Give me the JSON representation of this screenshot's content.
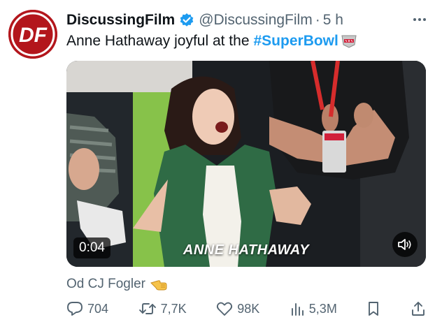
{
  "author": {
    "name": "DiscussingFilm",
    "handle": "@DiscussingFilm",
    "separator": "·",
    "time": "5 h",
    "avatar_text": "DF",
    "avatar_color": "#b3161c",
    "verified_color": "#1d9bf0"
  },
  "tweet": {
    "text": "Anne Hathaway joyful at the",
    "hashtag": "#SuperBowl",
    "hashtag_color": "#1d9bf0"
  },
  "media": {
    "duration": "0:04",
    "caption": "ANNE HATHAWAY",
    "sound_icon": "speaker-muted-icon"
  },
  "credit": {
    "text": "Od CJ Fogler",
    "emoji": "pointing-hand-emoji"
  },
  "actions": {
    "replies": "704",
    "reposts": "7,7K",
    "likes": "98K",
    "views": "5,3M"
  }
}
